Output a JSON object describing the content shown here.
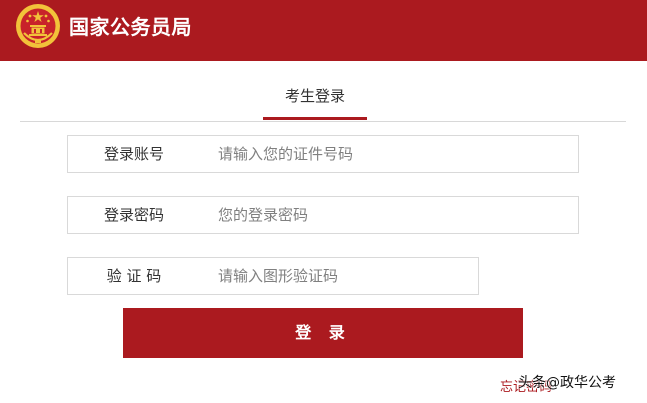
{
  "header": {
    "title": "国家公务员局",
    "emblem_icon": "national-emblem-icon"
  },
  "tabs": [
    {
      "label": "考生登录",
      "active": true
    }
  ],
  "form": {
    "account": {
      "label": "登录账号",
      "placeholder": "请输入您的证件号码"
    },
    "password": {
      "label": "登录密码",
      "placeholder": "您的登录密码"
    },
    "captcha": {
      "label": "验 证 码",
      "placeholder": "请输入图形验证码"
    },
    "submit_label": "登 录",
    "forgot_label": "忘记密码"
  },
  "watermark": "头条@政华公考",
  "colors": {
    "brand_red": "#ab1a1f",
    "emblem_gold": "#f2c23a",
    "text_dark": "#333333",
    "placeholder": "#808080",
    "border": "#d9d9d9"
  }
}
